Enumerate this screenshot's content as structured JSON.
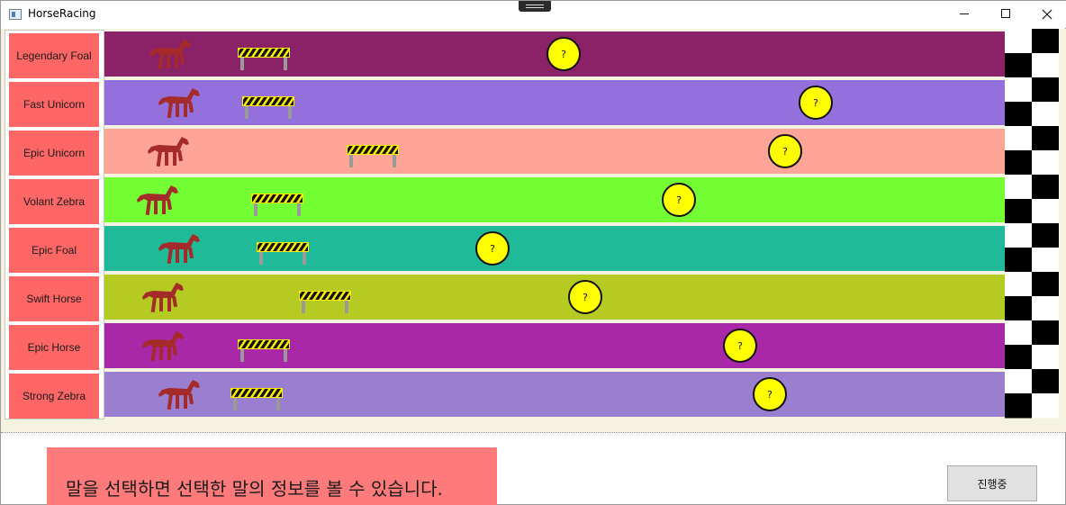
{
  "window": {
    "title": "HorseRacing"
  },
  "titlebar": {
    "minimize_label": "–",
    "maximize_label": "☐",
    "close_label": "✕"
  },
  "icons": {
    "app": "app-window-icon",
    "horse": "horse-icon",
    "barrier": "barrier-icon",
    "coin": "question-coin-icon",
    "finish": "checkered-finish-flag"
  },
  "colors": {
    "horse_button": "#ff6666",
    "info_panel": "#ff7b7b",
    "coin": "#ffff00",
    "horse": "#a52a2a"
  },
  "horses": [
    {
      "name": "Legendary Foal",
      "lane_color": "#8b2167",
      "coin_label": "?"
    },
    {
      "name": "Fast Unicorn",
      "lane_color": "#9370db",
      "coin_label": "?"
    },
    {
      "name": "Epic Unicorn",
      "lane_color": "#ffa597",
      "coin_label": "?"
    },
    {
      "name": "Volant Zebra",
      "lane_color": "#74ff34",
      "coin_label": "?"
    },
    {
      "name": "Epic Foal",
      "lane_color": "#1fba98",
      "coin_label": "?"
    },
    {
      "name": "Swift Horse",
      "lane_color": "#b6cb22",
      "coin_label": "?"
    },
    {
      "name": "Epic Horse",
      "lane_color": "#a828a8",
      "coin_label": "?"
    },
    {
      "name": "Strong Zebra",
      "lane_color": "#9a7fd0",
      "coin_label": "?"
    }
  ],
  "info": {
    "message": "말을 선택하면 선택한 말의 정보를 볼 수 있습니다."
  },
  "status_button": {
    "label": "진행중"
  }
}
